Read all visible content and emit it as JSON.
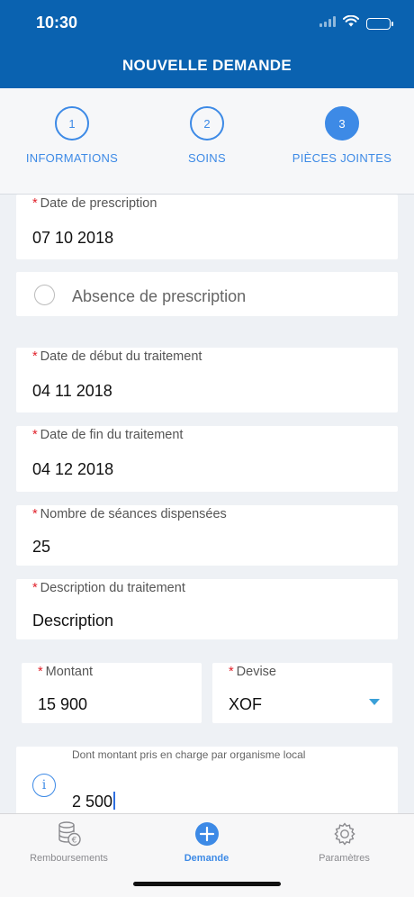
{
  "status": {
    "time": "10:30"
  },
  "header": {
    "title": "NOUVELLE DEMANDE"
  },
  "steps": [
    {
      "number": "1",
      "label": "INFORMATIONS"
    },
    {
      "number": "2",
      "label": "SOINS"
    },
    {
      "number": "3",
      "label": "PIÈCES JOINTES"
    }
  ],
  "form": {
    "prescription_date": {
      "label": "Date de prescription",
      "value": "07 10 2018"
    },
    "no_prescription": {
      "label": "Absence de prescription"
    },
    "start_date": {
      "label": "Date de début du traitement",
      "value": "04 11 2018"
    },
    "end_date": {
      "label": "Date de fin du traitement",
      "value": "04 12 2018"
    },
    "sessions": {
      "label": "Nombre de séances dispensées",
      "value": "25"
    },
    "description": {
      "label": "Description du traitement",
      "value": "Description"
    },
    "amount": {
      "label": "Montant",
      "value": "15 900"
    },
    "currency": {
      "label": "Devise",
      "value": "XOF"
    },
    "local_amount": {
      "label": "Dont montant pris en charge par organisme local",
      "value": "2 500"
    }
  },
  "tabs": {
    "reimbursements": "Remboursements",
    "request": "Demande",
    "settings": "Paramètres"
  },
  "colors": {
    "header": "#0a62b0",
    "accent": "#3d8ae6",
    "required": "#e0202a"
  }
}
